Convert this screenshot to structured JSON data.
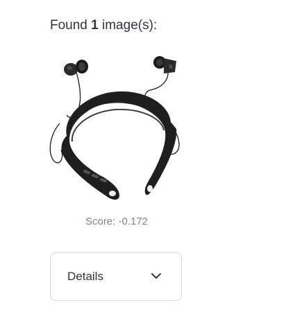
{
  "results": {
    "found_prefix": "Found ",
    "found_count": "1",
    "found_suffix": " image(s):"
  },
  "image": {
    "subject": "black neckband bluetooth earphones",
    "caption": "Score: -0.172"
  },
  "details": {
    "label": "Details",
    "icon": "chevron-down-icon"
  }
}
